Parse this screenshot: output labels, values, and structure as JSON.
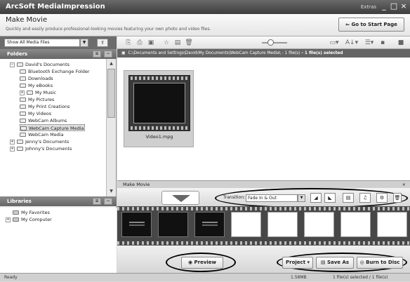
{
  "app": {
    "title": "ArcSoft MediaImpression",
    "extras_label": "Extras"
  },
  "header": {
    "title": "Make Movie",
    "subtitle": "Quickly and easily produce professional-looking movies featuring your own photo and video files.",
    "start_page_label": "Go to Start Page"
  },
  "left": {
    "filter": "Show All Media Files",
    "folders_title": "Folders",
    "libraries_title": "Libraries",
    "tree": [
      {
        "label": "David's Documents",
        "indent": 1,
        "exp": "−"
      },
      {
        "label": "Bluetooth Exchange Folder",
        "indent": 2
      },
      {
        "label": "Downloads",
        "indent": 2
      },
      {
        "label": "My eBooks",
        "indent": 2
      },
      {
        "label": "My Music",
        "indent": 2,
        "exp": "+"
      },
      {
        "label": "My Pictures",
        "indent": 2
      },
      {
        "label": "My Print Creations",
        "indent": 2
      },
      {
        "label": "My Videos",
        "indent": 2
      },
      {
        "label": "WebCam Albums",
        "indent": 2
      },
      {
        "label": "WebCam Capture Media",
        "indent": 2,
        "selected": true
      },
      {
        "label": "WebCam Media",
        "indent": 2
      },
      {
        "label": "Jenny's Documents",
        "indent": 1,
        "exp": "+"
      },
      {
        "label": "Johnny's Documents",
        "indent": 1,
        "exp": "+"
      }
    ],
    "libraries": [
      {
        "label": "My Favorites",
        "exp": ""
      },
      {
        "label": "My Computer",
        "exp": "+"
      }
    ]
  },
  "path": {
    "text": "C:\\Documents and Settings\\David\\My Documents\\WebCam Capture Media\\ - 1 file(s)",
    "selected": " - 1 file(s) selected"
  },
  "media": [
    {
      "label": "Video1.mpg"
    }
  ],
  "make_movie": {
    "title": "Make Movie",
    "transition_label": "Transition:",
    "transition_value": "Fade In & Out",
    "storyboard": [
      {
        "kind": "clip-title"
      },
      {
        "kind": "clip-black"
      },
      {
        "kind": "clip-title"
      },
      {
        "kind": "empty"
      },
      {
        "kind": "empty"
      },
      {
        "kind": "empty"
      },
      {
        "kind": "empty"
      },
      {
        "kind": "empty"
      }
    ]
  },
  "buttons": {
    "preview": "Preview",
    "project": "Project",
    "save_as": "Save As",
    "burn": "Burn to Disc"
  },
  "status": {
    "left": "Ready",
    "size": "1.58MB",
    "selection": "1 file(s) selected / 1 file(s)"
  }
}
